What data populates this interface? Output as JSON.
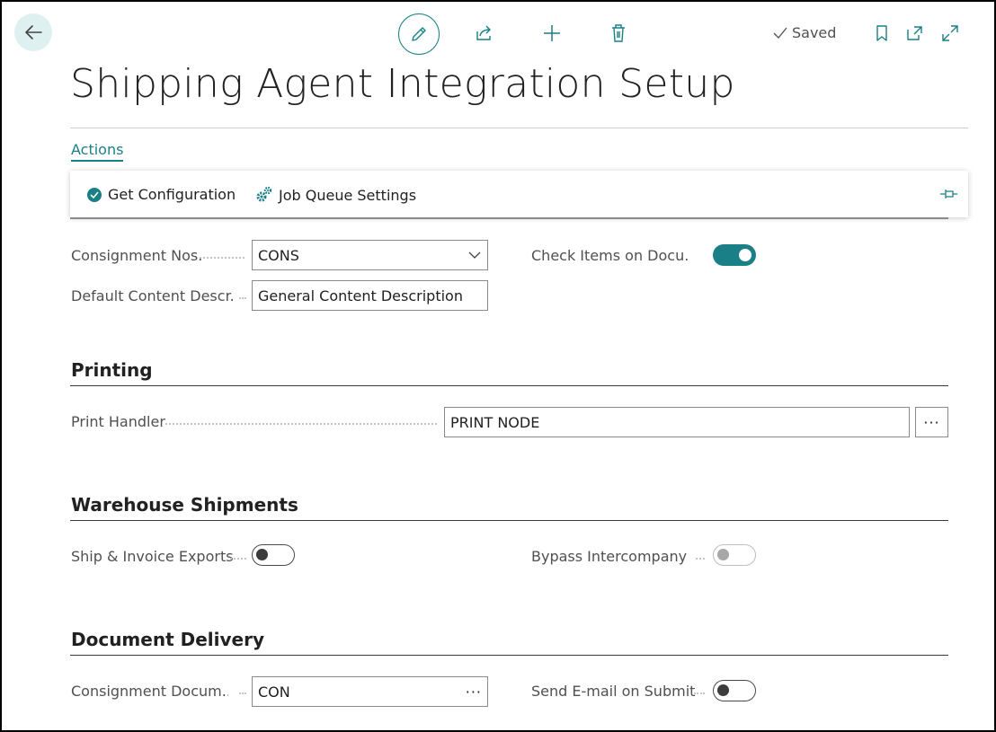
{
  "header": {
    "title": "Shipping Agent Integration Setup",
    "saved_label": "Saved",
    "icons": [
      "back-arrow-icon",
      "edit-pencil-icon",
      "share-icon",
      "new-plus-icon",
      "delete-trash-icon",
      "check-icon",
      "bookmark-icon",
      "open-new-window-icon",
      "expand-icon"
    ]
  },
  "actions_tab": {
    "label": "Actions"
  },
  "action_bar": {
    "items": [
      {
        "label": "Get Configuration",
        "icon": "check-circle-icon"
      },
      {
        "label": "Job Queue Settings",
        "icon": "gears-icon"
      }
    ],
    "pin_icon": "pin-icon"
  },
  "general": {
    "consignment_nos": {
      "label": "Consignment Nos.",
      "value": "CONS"
    },
    "default_content_desc": {
      "label": "Default Content Descr...",
      "value": "General Content Description"
    },
    "check_items": {
      "label": "Check Items on Docu...",
      "value": true
    }
  },
  "printing": {
    "title": "Printing",
    "print_handler": {
      "label": "Print Handler",
      "value": "PRINT NODE",
      "assist": "···"
    }
  },
  "warehouse": {
    "title": "Warehouse Shipments",
    "ship_invoice_exports": {
      "label": "Ship & Invoice Exports",
      "value": false
    },
    "bypass_intercompany": {
      "label": "Bypass Intercompany ...",
      "value": false,
      "disabled": true
    }
  },
  "delivery": {
    "title": "Document Delivery",
    "consignment_doc": {
      "label": "Consignment Docum...",
      "value": "CON",
      "assist": "···"
    },
    "send_email": {
      "label": "Send E-mail on Submit",
      "value": false
    }
  },
  "colors": {
    "accent": "#1a7f86",
    "back_bg": "#dff0f0"
  }
}
